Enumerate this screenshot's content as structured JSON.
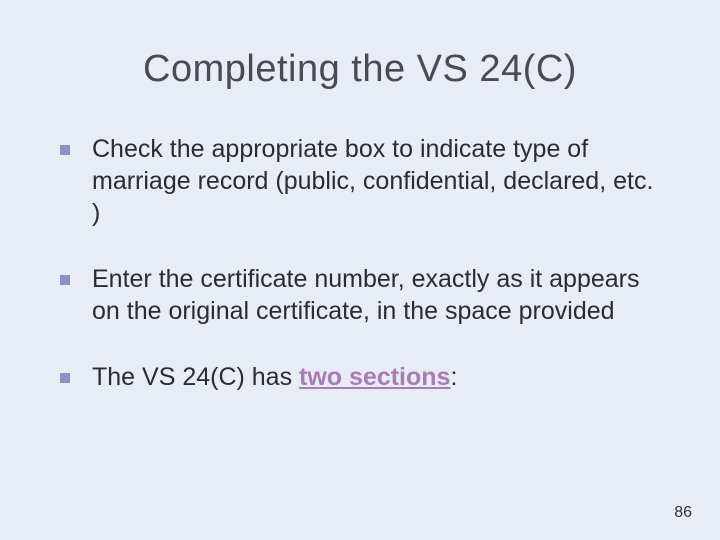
{
  "slide": {
    "title": "Completing the VS 24(C)",
    "bullets": [
      {
        "text": "Check the appropriate box to indicate type of marriage record (public, confidential, declared, etc. )"
      },
      {
        "text": "Enter the certificate number, exactly as it appears on the original certificate, in the space provided"
      },
      {
        "prefix": "The VS 24(C) has ",
        "link": "two sections",
        "suffix": ":"
      }
    ],
    "page_number": "86"
  }
}
